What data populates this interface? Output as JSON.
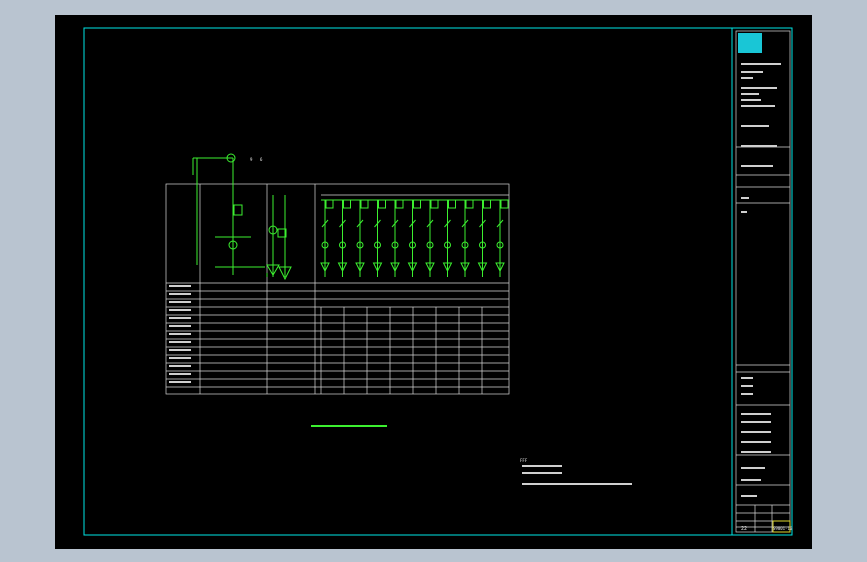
{
  "drawing": {
    "cell_size_labels": [
      "9",
      "6"
    ],
    "bus_note_label": "FFF",
    "sheet_number": "22"
  },
  "title_block": {
    "logo_label": "logo",
    "sheet_code": "S9001-10",
    "colors": {
      "frame": "#00e6e6",
      "lines": "#d8d8d8",
      "symbols": "#3cf030",
      "accent": "#e0d830",
      "logo": "#19c6d6"
    }
  }
}
